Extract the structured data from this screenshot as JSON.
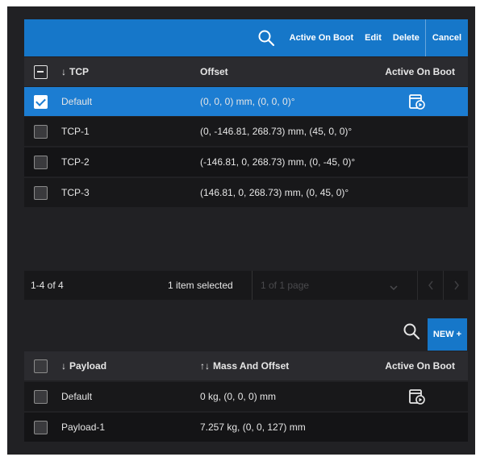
{
  "tcp_toolbar": {
    "search_icon": "search-icon",
    "active_on_boot": "Active On Boot",
    "edit": "Edit",
    "delete": "Delete",
    "cancel": "Cancel"
  },
  "tcp_table": {
    "headers": {
      "name": "TCP",
      "name_sort": "↓",
      "offset": "Offset",
      "boot": "Active On Boot"
    },
    "rows": [
      {
        "name": "Default",
        "offset": "(0, 0, 0) mm, (0, 0, 0)°",
        "checked": true,
        "active_on_boot": true
      },
      {
        "name": "TCP-1",
        "offset": "(0, -146.81, 268.73) mm, (45, 0, 0)°",
        "checked": false,
        "active_on_boot": false
      },
      {
        "name": "TCP-2",
        "offset": "(-146.81, 0, 268.73) mm, (0, -45, 0)°",
        "checked": false,
        "active_on_boot": false
      },
      {
        "name": "TCP-3",
        "offset": "(146.81, 0, 268.73) mm, (0, 45, 0)°",
        "checked": false,
        "active_on_boot": false
      }
    ]
  },
  "pagination": {
    "count": "1-4 of 4",
    "selected": "1 item selected",
    "page_of": "1 of 1 page",
    "page_dropdown_icon": "chevron-down-icon",
    "prev_icon": "chevron-left-icon",
    "next_icon": "chevron-right-icon"
  },
  "payload_toolbar": {
    "search_icon": "search-icon",
    "new_label": "NEW +"
  },
  "payload_table": {
    "headers": {
      "name": "Payload",
      "name_sort": "↓",
      "mass": "Mass And Offset",
      "mass_sort": "↑↓",
      "boot": "Active On Boot"
    },
    "rows": [
      {
        "name": "Default",
        "mass": "0 kg, (0, 0, 0) mm",
        "checked": false,
        "active_on_boot": true
      },
      {
        "name": "Payload-1",
        "mass": "7.257 kg, (0, 0, 127) mm",
        "checked": false,
        "active_on_boot": false
      }
    ]
  },
  "colors": {
    "accent": "#1677c9",
    "selected_row": "#1c7dd2",
    "panel": "#212124"
  }
}
